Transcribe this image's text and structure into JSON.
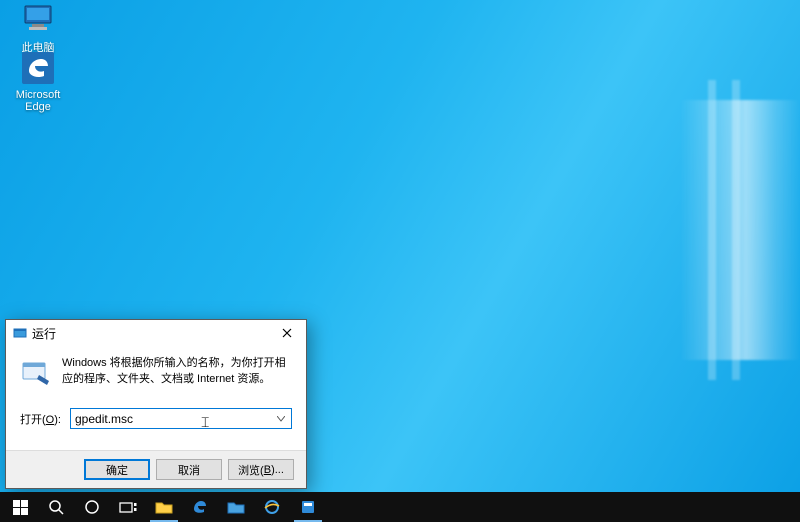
{
  "desktop": {
    "icons": {
      "this_pc": {
        "label": "此电脑"
      },
      "edge": {
        "label": "Microsoft\nEdge"
      }
    }
  },
  "run_dialog": {
    "title": "运行",
    "description": "Windows 将根据你所输入的名称，为你打开相应的程序、文件夹、文档或 Internet 资源。",
    "open_label": "打开(O):",
    "open_value": "gpedit.msc",
    "buttons": {
      "ok": "确定",
      "cancel": "取消",
      "browse": "浏览(B)..."
    }
  },
  "taskbar": {
    "items": [
      {
        "name": "start",
        "icon": "windows-logo-icon"
      },
      {
        "name": "search",
        "icon": "search-icon"
      },
      {
        "name": "cortana",
        "icon": "cortana-circle-icon"
      },
      {
        "name": "task-view",
        "icon": "task-view-icon"
      },
      {
        "name": "file-explorer",
        "icon": "folder-icon"
      },
      {
        "name": "edge",
        "icon": "edge-icon"
      },
      {
        "name": "explorer2",
        "icon": "folder-icon"
      },
      {
        "name": "ie",
        "icon": "ie-icon"
      },
      {
        "name": "app",
        "icon": "app-icon"
      }
    ]
  },
  "colors": {
    "accent": "#0078d7"
  }
}
